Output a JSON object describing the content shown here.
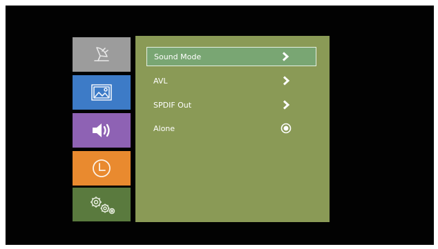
{
  "colors": {
    "screen_bg": "#020202",
    "panel_bg": "#8a9a56",
    "selected_row_bg": "#79a673",
    "tab_channel": "#9c9c9c",
    "tab_picture": "#3d7bc7",
    "tab_sound": "#8e62b4",
    "tab_time": "#e98a2f",
    "tab_setup": "#5a7a3e"
  },
  "sidebar": {
    "tabs": [
      {
        "id": "channel",
        "icon": "satellite-dish-icon",
        "active": false
      },
      {
        "id": "picture",
        "icon": "picture-icon",
        "active": false
      },
      {
        "id": "sound",
        "icon": "speaker-icon",
        "active": true
      },
      {
        "id": "time",
        "icon": "clock-icon",
        "active": false
      },
      {
        "id": "setup",
        "icon": "gears-icon",
        "active": false
      }
    ]
  },
  "menu": {
    "items": [
      {
        "label": "Sound Mode",
        "control": "chevron-right-icon",
        "selected": true
      },
      {
        "label": "AVL",
        "control": "chevron-right-icon",
        "selected": false
      },
      {
        "label": "SPDIF Out",
        "control": "chevron-right-icon",
        "selected": false
      },
      {
        "label": "Alone",
        "control": "radio-icon",
        "selected": false
      }
    ]
  }
}
